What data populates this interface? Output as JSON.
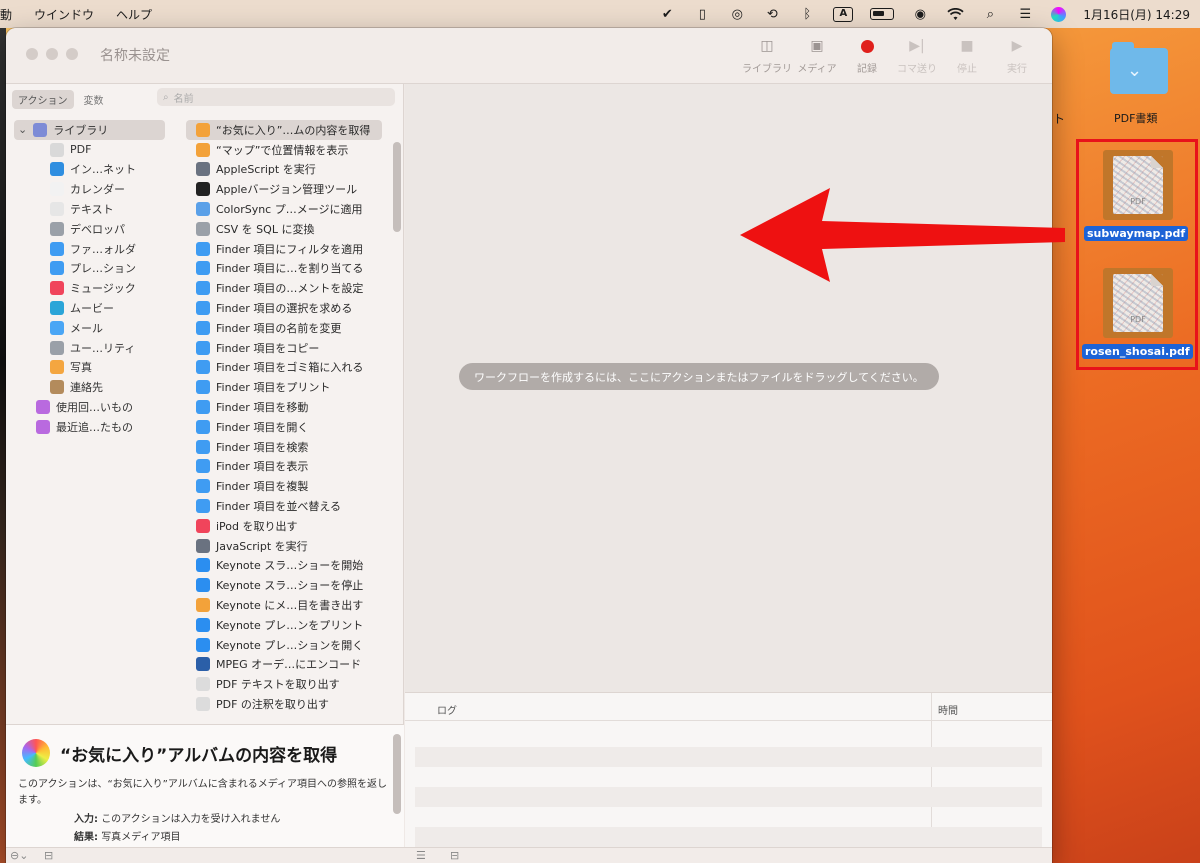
{
  "menubar": {
    "items": [
      "動",
      "ウインドウ",
      "ヘルプ"
    ],
    "input_mode": "A",
    "datetime": "1月16日(月)  14:29"
  },
  "window": {
    "title": "名称未設定",
    "toolbar": {
      "library": "ライブラリ",
      "media": "メディア",
      "record": "記録",
      "step": "コマ送り",
      "stop": "停止",
      "run": "実行"
    }
  },
  "library": {
    "tabs": [
      "アクション",
      "変数"
    ],
    "search_placeholder": "名前",
    "categories": [
      {
        "label": "ライブラリ",
        "color": "#7d8bd6"
      },
      {
        "label": "PDF",
        "color": "#d9d9d9"
      },
      {
        "label": "イン…ネット",
        "color": "#2f8ee0"
      },
      {
        "label": "カレンダー",
        "color": "#f2f2f2"
      },
      {
        "label": "テキスト",
        "color": "#e6e6e6"
      },
      {
        "label": "デベロッパ",
        "color": "#9aa0a8"
      },
      {
        "label": "ファ…ォルダ",
        "color": "#3f9cf2"
      },
      {
        "label": "プレ…ション",
        "color": "#3f9cf2"
      },
      {
        "label": "ミュージック",
        "color": "#f0445b"
      },
      {
        "label": "ムービー",
        "color": "#2ba5d8"
      },
      {
        "label": "メール",
        "color": "#4aa6f5"
      },
      {
        "label": "ユー…リティ",
        "color": "#9aa0a8"
      },
      {
        "label": "写真",
        "color": "#f4a640"
      },
      {
        "label": "連絡先",
        "color": "#b38b5c"
      },
      {
        "label": "使用回…いもの",
        "color": "#b96adf"
      },
      {
        "label": "最近追…たもの",
        "color": "#b96adf"
      }
    ],
    "actions": [
      "“お気に入り”…ムの内容を取得",
      "“マップ”で位置情報を表示",
      "AppleScript を実行",
      "Appleバージョン管理ツール",
      "ColorSync プ…メージに適用",
      "CSV を SQL に変換",
      "Finder 項目にフィルタを適用",
      "Finder 項目に…を割り当てる",
      "Finder 項目の…メントを設定",
      "Finder 項目の選択を求める",
      "Finder 項目の名前を変更",
      "Finder 項目をコピー",
      "Finder 項目をゴミ箱に入れる",
      "Finder 項目をプリント",
      "Finder 項目を移動",
      "Finder 項目を開く",
      "Finder 項目を検索",
      "Finder 項目を表示",
      "Finder 項目を複製",
      "Finder 項目を並べ替える",
      "iPod を取り出す",
      "JavaScript を実行",
      "Keynote スラ…ショーを開始",
      "Keynote スラ…ショーを停止",
      "Keynote にメ…目を書き出す",
      "Keynote プレ…ンをプリント",
      "Keynote プレ…ションを開く",
      "MPEG オーデ…にエンコード",
      "PDF テキストを取り出す",
      "PDF の注釈を取り出す"
    ]
  },
  "description": {
    "title": "“お気に入り”アルバムの内容を取得",
    "body": "このアクションは、“お気に入り”アルバムに含まれるメディア項目への参照を返します。",
    "input_label": "入力:",
    "input_value": "このアクションは入力を受け入れません",
    "result_label": "結果:",
    "result_value": "写真メディア項目"
  },
  "workflow": {
    "hint": "ワークフローを作成するには、ここにアクションまたはファイルをドラッグしてください。"
  },
  "log": {
    "col_log": "ログ",
    "col_time": "時間"
  },
  "desktop": {
    "folder_label": "PDF書類",
    "partial_label": "ト",
    "files": [
      "subwaymap.pdf",
      "rosen_shosai.pdf"
    ],
    "pdf_badge": "PDF"
  },
  "colors": {
    "highlight_box": "#e8121a",
    "arrow": "#ee1111",
    "selection": "#1d63d6",
    "record": "#e0201c"
  }
}
